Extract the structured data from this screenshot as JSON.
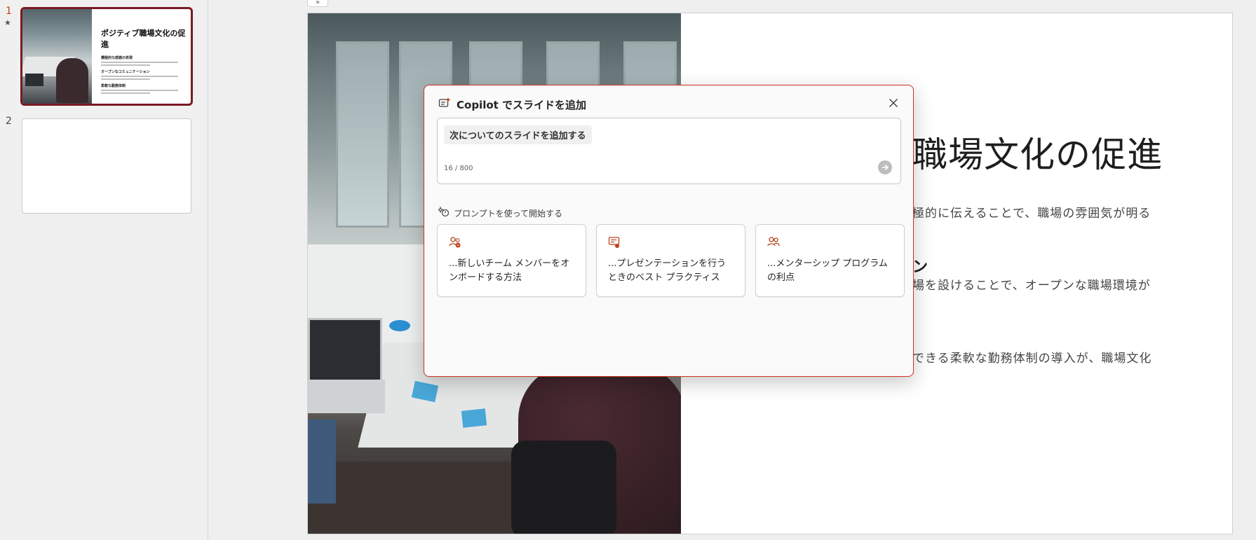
{
  "thumbnails": {
    "slides": [
      {
        "number": "1",
        "marker": "★"
      },
      {
        "number": "2"
      }
    ],
    "slide1": {
      "title": "ポジティブ職場文化の促進",
      "heads": [
        "積極的な感謝の表現",
        "オープンなコミュニケーション",
        "柔軟な勤務体制"
      ]
    }
  },
  "main": {
    "collapse_icon": "»",
    "slide_title": "職場文化の促進",
    "lines": [
      "極的に伝えることで、職場の雰囲気が明る",
      "場を設けることで、オープンな職場環境が",
      "できる柔軟な勤務体制の導入が、職場文化"
    ],
    "heading_fragment": "ン"
  },
  "dialog": {
    "title": "Copilot でスライドを追加",
    "prompt_chip": "次についてのスライドを追加する",
    "counter": "16 / 800",
    "start_label": "プロンプトを使って開始する",
    "cards": [
      {
        "text": "...新しいチーム メンバーをオンボードする方法",
        "icon": "onboard-people-icon"
      },
      {
        "text": "...プレゼンテーションを行うときのベスト プラクティス",
        "icon": "presentation-icon"
      },
      {
        "text": "...メンターシップ プログラムの利点",
        "icon": "mentorship-people-icon"
      }
    ]
  },
  "colors": {
    "accent": "#c43e1c",
    "selected_border": "#7a1a23",
    "dialog_border": "#c9341d"
  }
}
